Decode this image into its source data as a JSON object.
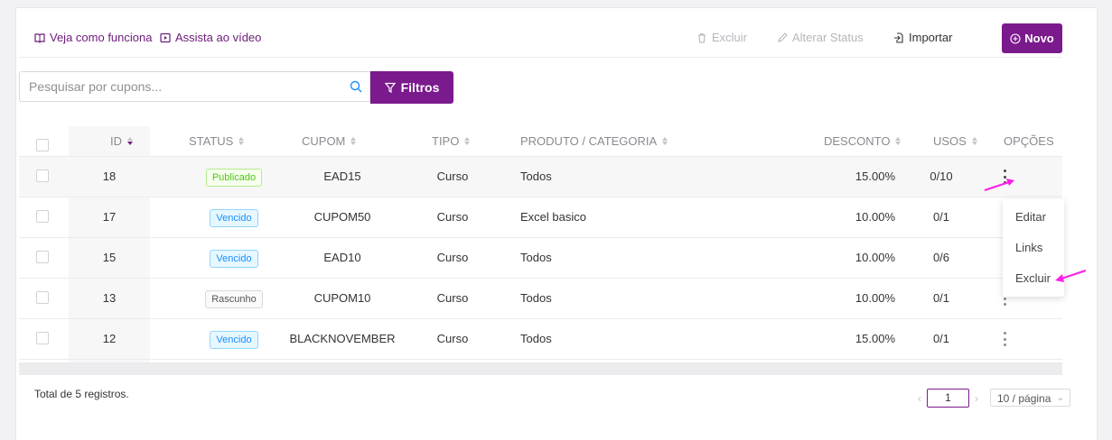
{
  "toolbar": {
    "help_link": "Veja como funciona",
    "video_link": "Assista ao vídeo",
    "excluir": "Excluir",
    "alterar_status": "Alterar Status",
    "importar": "Importar",
    "novo": "Novo"
  },
  "search": {
    "placeholder": "Pesquisar por cupons...",
    "filter_label": "Filtros"
  },
  "table": {
    "columns": {
      "id": "ID",
      "status": "STATUS",
      "cupom": "CUPOM",
      "tipo": "TIPO",
      "produto": "PRODUTO / CATEGORIA",
      "desconto": "DESCONTO",
      "usos": "USOS",
      "opcoes": "OPÇÕES"
    },
    "rows": [
      {
        "id": "18",
        "status": "Publicado",
        "status_color": "green",
        "cupom": "EAD15",
        "tipo": "Curso",
        "produto": "Todos",
        "desconto": "15.00%",
        "usos": "0/10"
      },
      {
        "id": "17",
        "status": "Vencido",
        "status_color": "blue",
        "cupom": "CUPOM50",
        "tipo": "Curso",
        "produto": "Excel basico",
        "desconto": "10.00%",
        "usos": "0/1"
      },
      {
        "id": "15",
        "status": "Vencido",
        "status_color": "blue",
        "cupom": "EAD10",
        "tipo": "Curso",
        "produto": "Todos",
        "desconto": "10.00%",
        "usos": "0/6"
      },
      {
        "id": "13",
        "status": "Rascunho",
        "status_color": "gray",
        "cupom": "CUPOM10",
        "tipo": "Curso",
        "produto": "Todos",
        "desconto": "10.00%",
        "usos": "0/1"
      },
      {
        "id": "12",
        "status": "Vencido",
        "status_color": "blue",
        "cupom": "BLACKNOVEMBER",
        "tipo": "Curso",
        "produto": "Todos",
        "desconto": "15.00%",
        "usos": "0/1"
      }
    ]
  },
  "options_menu": {
    "editar": "Editar",
    "links": "Links",
    "excluir": "Excluir"
  },
  "footer": {
    "total": "Total de 5 registros.",
    "page": "1",
    "page_size": "10 / página"
  },
  "colors": {
    "accent": "#7b1a8c",
    "annotation": "#ff1ee6"
  }
}
